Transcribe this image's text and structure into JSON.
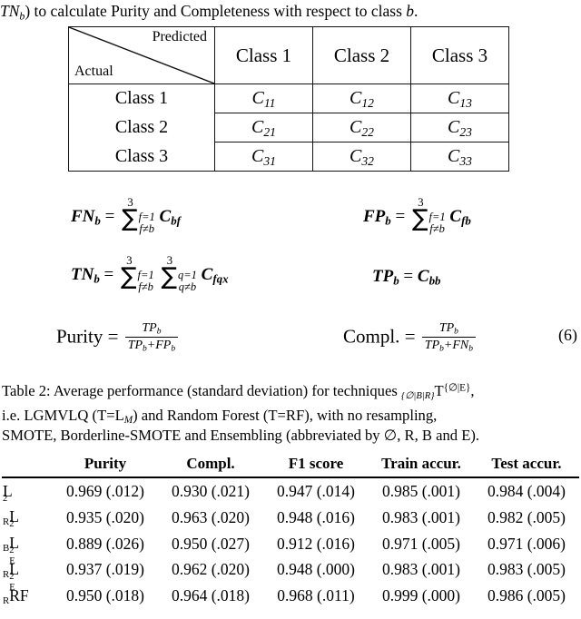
{
  "intro": {
    "text_pre": "TN",
    "text_sub": "b",
    "text_post": ") to calculate Purity and Completeness with respect to class ",
    "text_end": "b",
    "text_period": "."
  },
  "confusion_matrix": {
    "corner_predicted": "Predicted",
    "corner_actual": "Actual",
    "column_headers": [
      "Class 1",
      "Class 2",
      "Class 3"
    ],
    "row_labels": [
      "Class 1",
      "Class 2",
      "Class 3"
    ],
    "cells": [
      [
        {
          "base": "C",
          "sub": "11"
        },
        {
          "base": "C",
          "sub": "12"
        },
        {
          "base": "C",
          "sub": "13"
        }
      ],
      [
        {
          "base": "C",
          "sub": "21"
        },
        {
          "base": "C",
          "sub": "22"
        },
        {
          "base": "C",
          "sub": "23"
        }
      ],
      [
        {
          "base": "C",
          "sub": "31"
        },
        {
          "base": "C",
          "sub": "32"
        },
        {
          "base": "C",
          "sub": "33"
        }
      ]
    ]
  },
  "equations": {
    "fn": {
      "lhs_base": "FN",
      "lhs_sub": "b",
      "eq": "=",
      "sum_top": "3",
      "sum_lower1": "f=1",
      "sum_lower2": "f≠b",
      "term_base": "C",
      "term_sub": "bf"
    },
    "fp": {
      "lhs_base": "FP",
      "lhs_sub": "b",
      "eq": "=",
      "sum_top": "3",
      "sum_lower1": "f=1",
      "sum_lower2": "f≠b",
      "term_base": "C",
      "term_sub": "fb"
    },
    "tn": {
      "lhs_base": "TN",
      "lhs_sub": "b",
      "eq": "=",
      "sum1_top": "3",
      "sum1_lower1": "f=1",
      "sum1_lower2": "f≠b",
      "sum2_top": "3",
      "sum2_lower1": "q=1",
      "sum2_lower2": "q≠b",
      "term_base": "C",
      "term_sub": "fqx"
    },
    "tp": {
      "lhs_base": "TP",
      "lhs_sub": "b",
      "eq": "=",
      "rhs_base": "C",
      "rhs_sub": "bb"
    },
    "purity": {
      "label": "Purity",
      "eq": "=",
      "numerator": "TP",
      "numerator_sub": "b",
      "denominator": "TP",
      "denominator_sub": "b",
      "denominator_plus": "+FP",
      "denominator_sub2": "b"
    },
    "compl": {
      "label": "Compl.",
      "eq": "=",
      "numerator": "TP",
      "numerator_sub": "b",
      "denominator": "TP",
      "denominator_sub": "b",
      "denominator_plus": "+FN",
      "denominator_sub2": "b",
      "number": "(6)"
    }
  },
  "caption": {
    "line1_a": "Table 2: Average performance (standard deviation) for techniques ",
    "line1_presub": "{∅|B|R}",
    "line1_T": "T",
    "line1_sup": "{∅|E}",
    "line1_end": ",",
    "line2_a": "i.e. LGMVLQ (T=L",
    "line2_sub": "M",
    "line2_b": ") and Random Forest (T=RF), with no resampling,",
    "line3": "SMOTE, Borderline-SMOTE and Ensembling (abbreviated by ∅, R, B and E)."
  },
  "results_table": {
    "columns": [
      "",
      "Purity",
      "Compl.",
      "F1 score",
      "Train accur.",
      "Test accur."
    ],
    "rows": [
      {
        "label_pre": "",
        "label_base": "L",
        "label_sub": "2",
        "label_sup": "",
        "values": [
          "0.969 (.012)",
          "0.930 (.021)",
          "0.947 (.014)",
          "0.985 (.001)",
          "0.984 (.004)"
        ]
      },
      {
        "label_pre": "R",
        "label_base": "L",
        "label_sub": "2",
        "label_sup": "",
        "values": [
          "0.935 (.020)",
          "0.963 (.020)",
          "0.948 (.016)",
          "0.983 (.001)",
          "0.982 (.005)"
        ]
      },
      {
        "label_pre": "B",
        "label_base": "L",
        "label_sub": "2",
        "label_sup": "",
        "values": [
          "0.889 (.026)",
          "0.950 (.027)",
          "0.912 (.016)",
          "0.971 (.005)",
          "0.971 (.006)"
        ]
      },
      {
        "label_pre": "R",
        "label_base": "L",
        "label_sub": "2",
        "label_sup": "E",
        "values": [
          "0.937 (.019)",
          "0.962 (.020)",
          "0.948 (.000)",
          "0.983 (.001)",
          "0.983 (.005)"
        ]
      },
      {
        "label_pre": "R",
        "label_base": "RF",
        "label_sub": "",
        "label_sup": "E",
        "values": [
          "0.950 (.018)",
          "0.964 (.018)",
          "0.968 (.011)",
          "0.999 (.000)",
          "0.986 (.005)"
        ]
      }
    ]
  }
}
